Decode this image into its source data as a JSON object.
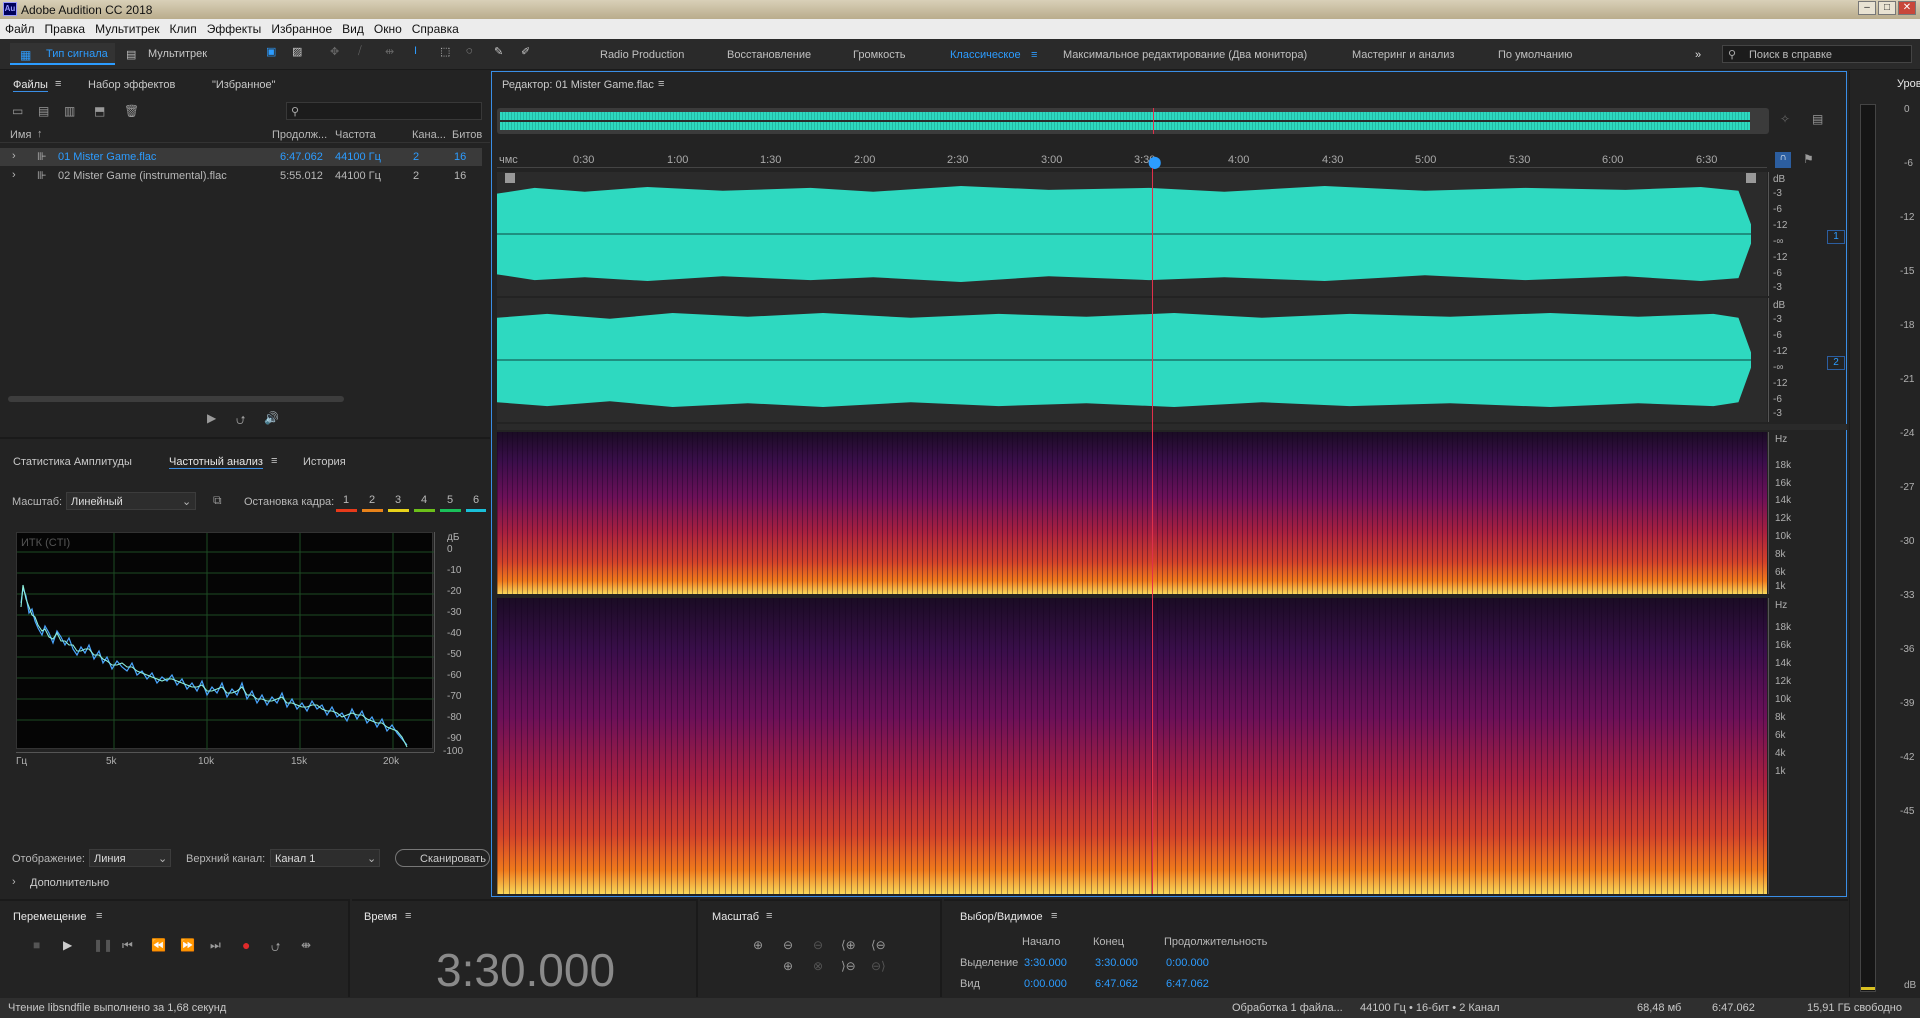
{
  "window": {
    "title": "Adobe Audition CC 2018",
    "app_logo": "Au"
  },
  "menu": [
    "Файл",
    "Правка",
    "Мультитрек",
    "Клип",
    "Эффекты",
    "Избранное",
    "Вид",
    "Окно",
    "Справка"
  ],
  "toolbar": {
    "waveform_label": "Тип сигнала",
    "multitrack_label": "Мультитрек",
    "workspaces": [
      "Radio Production",
      "Восстановление",
      "Громкость",
      "Классическое",
      "Максимальное редактирование (Два монитора)",
      "Мастеринг и анализ",
      "По умолчанию"
    ],
    "active_workspace": "Классическое",
    "help_search_placeholder": "Поиск в справке"
  },
  "files_panel": {
    "tabs": [
      "Файлы",
      "Набор эффектов",
      "\"Избранное\""
    ],
    "columns": [
      "Имя",
      "Продолж...",
      "Частота",
      "Кана...",
      "Битов"
    ],
    "rows": [
      {
        "name": "01 Mister Game.flac",
        "duration": "6:47.062",
        "rate": "44100 Гц",
        "channels": "2",
        "bits": "16",
        "selected": true
      },
      {
        "name": "02 Mister Game (instrumental).flac",
        "duration": "5:55.012",
        "rate": "44100 Гц",
        "channels": "2",
        "bits": "16",
        "selected": false
      }
    ]
  },
  "analysis_panel": {
    "tabs": [
      "Статистика Амплитуды",
      "Частотный анализ",
      "История"
    ],
    "scale_label": "Масштаб:",
    "scale_value": "Линейный",
    "freeze_label": "Остановка кадра:",
    "freeze_slots": [
      "1",
      "2",
      "3",
      "4",
      "5",
      "6"
    ],
    "freeze_colors": [
      "#e83a1a",
      "#e8821a",
      "#e8d21a",
      "#6cc01a",
      "#1ac05a",
      "#1ac0d8"
    ],
    "graph_label": "ИТК (CTI)",
    "y_unit": "дБ",
    "y_ticks": [
      "0",
      "-10",
      "-20",
      "-30",
      "-40",
      "-50",
      "-60",
      "-70",
      "-80",
      "-90",
      "-100"
    ],
    "x_ticks": [
      "Гц",
      "5k",
      "10k",
      "15k",
      "20k"
    ],
    "display_label": "Отображение:",
    "display_value": "Линия",
    "top_channel_label": "Верхний канал:",
    "top_channel_value": "Канал 1",
    "scan_label": "Сканировать",
    "advanced_label": "Дополнительно"
  },
  "editor": {
    "title": "Редактор: 01 Mister Game.flac",
    "ruler_unit": "чмс",
    "ruler_ticks": [
      "0:30",
      "1:00",
      "1:30",
      "2:00",
      "2:30",
      "3:00",
      "3:30",
      "4:00",
      "4:30",
      "5:00",
      "5:30",
      "6:00",
      "6:30"
    ],
    "db_ticks": [
      "dB",
      "-3",
      "-6",
      "-12",
      "-∞",
      "-12",
      "-6",
      "-3"
    ],
    "channel_labels": [
      "1",
      "2"
    ],
    "hz_ticks": [
      "Hz",
      "18k",
      "16k",
      "14k",
      "12k",
      "10k",
      "8k",
      "6k",
      "4k",
      "2k",
      "1k"
    ],
    "playhead_time_fraction": 0.516
  },
  "levels": {
    "title": "Уровни",
    "ticks": [
      "0",
      "-3",
      "-6",
      "-9",
      "-12",
      "-15",
      "-18",
      "-21",
      "-24",
      "-27",
      "-30",
      "-33",
      "-36",
      "-39",
      "-42",
      "-45",
      "dB"
    ]
  },
  "transport": {
    "title": "Перемещение"
  },
  "time": {
    "title": "Время",
    "value": "3:30.000"
  },
  "zoom": {
    "title": "Масштаб"
  },
  "selection": {
    "title": "Выбор/Видимое",
    "cols": [
      "Начало",
      "Конец",
      "Продолжительность"
    ],
    "rows": [
      {
        "label": "Выделение",
        "start": "3:30.000",
        "end": "3:30.000",
        "dur": "0:00.000"
      },
      {
        "label": "Вид",
        "start": "0:00.000",
        "end": "6:47.062",
        "dur": "6:47.062"
      }
    ]
  },
  "status": {
    "left": "Чтение libsndfile выполнено за 1,68 секунд",
    "processing": "Обработка 1 файла...",
    "format": "44100 Гц • 16-бит • 2 Канал",
    "size": "68,48 мб",
    "duration": "6:47.062",
    "free": "15,91 ГБ свободно"
  },
  "colors": {
    "waveform": "#2ed9c0",
    "accent": "#2c9cff",
    "playhead": "#e0304a"
  }
}
